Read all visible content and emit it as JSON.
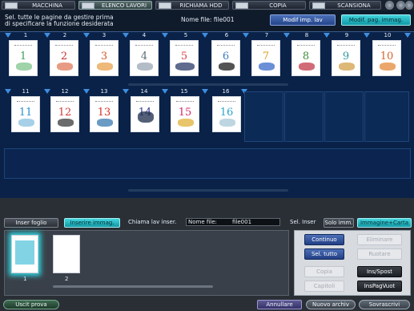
{
  "top_tabs": [
    {
      "label": "MACCHINA",
      "icon": "machine-icon",
      "active": false
    },
    {
      "label": "ELENCO LAVORI",
      "icon": "job-list-icon",
      "active": true
    },
    {
      "label": "RICHIAMA HDD",
      "icon": "hdd-icon",
      "active": false
    },
    {
      "label": "COPIA",
      "icon": "copy-icon",
      "active": false
    },
    {
      "label": "SCANSIONA",
      "icon": "scan-icon",
      "active": false
    }
  ],
  "header": {
    "instruction_line1": "Sel. tutte le pagine da gestire prima",
    "instruction_line2": "di specificare la funzione desiderata",
    "file_name": "Nome file: file001",
    "modif_imp_lav": "Modif imp. lav",
    "modif_pag_immag": "Modif. pag. immag."
  },
  "pages": [
    "1",
    "2",
    "3",
    "4",
    "5",
    "6",
    "7",
    "8",
    "9",
    "10",
    "11",
    "12",
    "13",
    "14",
    "15",
    "16"
  ],
  "page_digit_colors": [
    "#3fa24f",
    "#c8322f",
    "#d2582a",
    "#5f6b78",
    "#d4424a",
    "#3d7fc4",
    "#d9a21b",
    "#3a8f3a",
    "#2f9a9e",
    "#d9632a",
    "#2a8fd0",
    "#d63a3a",
    "#d2322a",
    "#3a3f9a",
    "#d22a6a",
    "#2aa6c8"
  ],
  "lower_tabs": {
    "inser_foglio": "Inser foglio",
    "inserire_immag": "Inserire immag.",
    "chiama_lav_inser": "Chiama lav inser.",
    "nome_file_label": "Nome file:",
    "nome_file_value": "file001",
    "sel_inser": "Sel. Inser",
    "solo_imm": "Solo imm.",
    "immagine_carta": "Immagine+Carta"
  },
  "thumbs": [
    "1",
    "2"
  ],
  "actions": {
    "continuo": "Continuo",
    "eliminare": "Eliminare",
    "sel_tutto": "Sel. tutto",
    "ruotare": "Ruotare",
    "copia": "Copia",
    "ins_spost": "Ins/Spost",
    "capitoli": "Capitoli",
    "ins_pag_vuot": "InsPagVuot"
  },
  "bottom": {
    "uscit_prova": "Uscit prova",
    "annullare": "Annullare",
    "nuovo_archiv": "Nuovo archiv",
    "sovrascrivi": "Sovrascrivi"
  },
  "colors": {
    "accent_cyan": "#1fb8c4",
    "accent_blue": "#2f53a0"
  }
}
